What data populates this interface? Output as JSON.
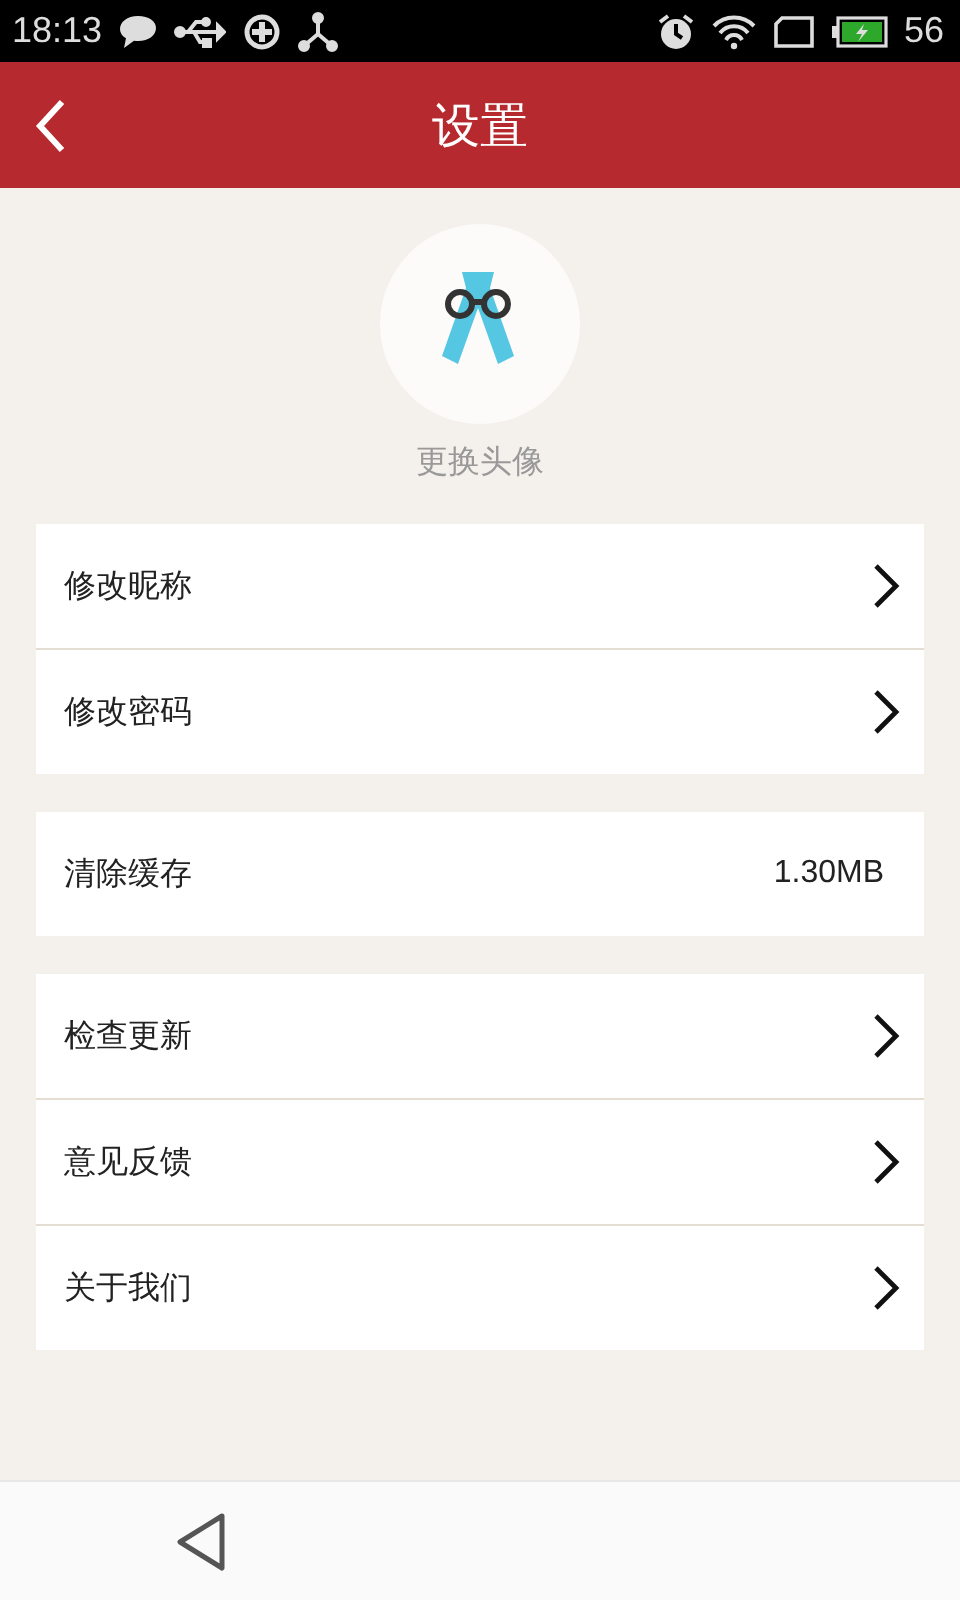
{
  "status_bar": {
    "time": "18:13",
    "battery": "56"
  },
  "header": {
    "title": "设置"
  },
  "avatar": {
    "label": "更换头像"
  },
  "groups": [
    {
      "rows": [
        {
          "kind": "link",
          "label": "修改昵称"
        },
        {
          "kind": "link",
          "label": "修改密码"
        }
      ]
    },
    {
      "rows": [
        {
          "kind": "value",
          "label": "清除缓存",
          "value": "1.30MB"
        }
      ]
    },
    {
      "rows": [
        {
          "kind": "link",
          "label": "检查更新"
        },
        {
          "kind": "link",
          "label": "意见反馈"
        },
        {
          "kind": "link",
          "label": "关于我们"
        }
      ]
    }
  ]
}
